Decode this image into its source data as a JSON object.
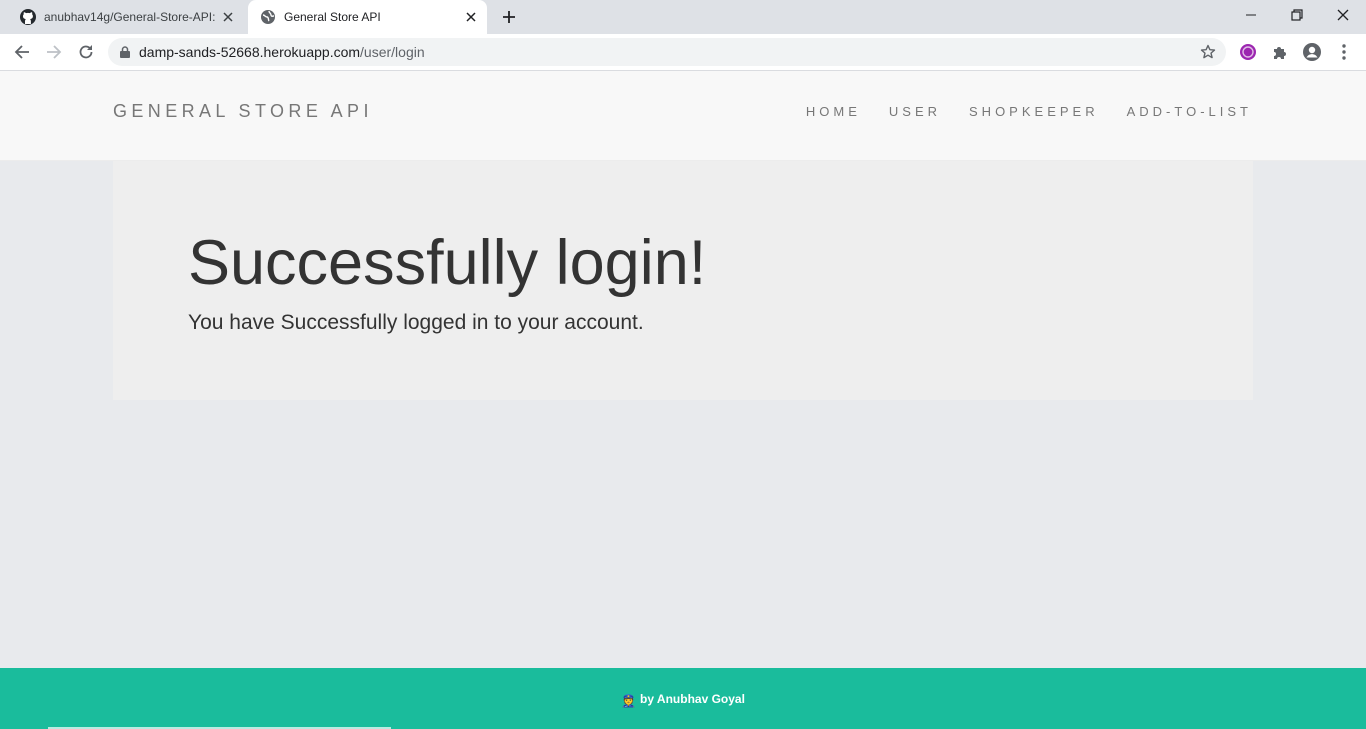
{
  "browser": {
    "tabs": [
      {
        "title": "anubhav14g/General-Store-API: T",
        "favicon": "github-icon",
        "active": false
      },
      {
        "title": "General Store API",
        "favicon": "globe-icon",
        "active": true
      }
    ],
    "address": {
      "host": "damp-sands-52668.herokuapp.com",
      "path": "/user/login"
    }
  },
  "site": {
    "brand": "GENERAL STORE API",
    "nav": [
      "HOME",
      "USER",
      "SHOPKEEPER",
      "ADD-TO-LIST"
    ]
  },
  "main": {
    "heading": "Successfully login!",
    "message": "You have Successfully logged in to your account."
  },
  "footer": {
    "emoji": "👮",
    "credit": "by Anubhav Goyal"
  },
  "colors": {
    "footer": "#1abc9c",
    "header_bg": "#f8f8f8",
    "jumbotron_bg": "#eeeeee",
    "page_bg": "#e8eaed"
  }
}
